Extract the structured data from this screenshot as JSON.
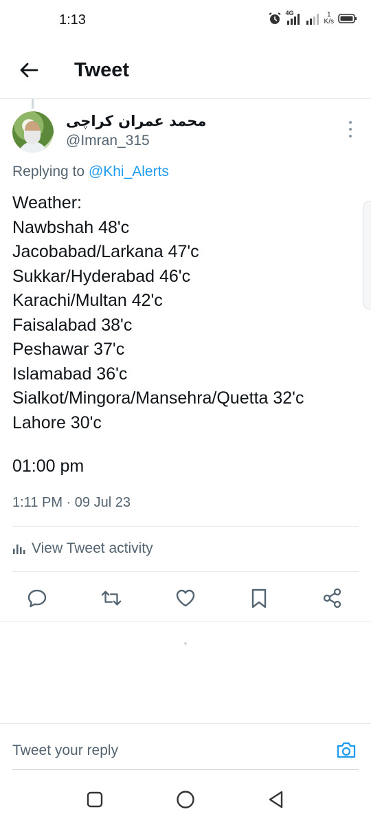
{
  "status_bar": {
    "time": "1:13",
    "network_type": "4G",
    "speed_value": "1",
    "speed_unit": "K/s",
    "icons": [
      "alarm-icon",
      "signal-icon",
      "signal-icon",
      "battery-icon"
    ]
  },
  "header": {
    "title": "Tweet",
    "back_icon": "arrow-left-icon"
  },
  "tweet": {
    "author_name": "محمد عمران کراچی",
    "author_handle": "@Imran_315",
    "replying_prefix": "Replying to",
    "replying_handle": "@Khi_Alerts",
    "lines": [
      "Weather:",
      "Nawbshah 48'c",
      "Jacobabad/Larkana 47'c",
      "Sukkar/Hyderabad 46'c",
      "Karachi/Multan 42'c",
      "Faisalabad 38'c",
      "Peshawar 37'c",
      "Islamabad 36'c",
      "Sialkot/Mingora/Mansehra/Quetta 32'c",
      "Lahore 30'c"
    ],
    "time_line": "01:00 pm",
    "timestamp": "1:11 PM · 09 Jul 23",
    "activity_label": "View Tweet activity"
  },
  "actions": [
    "reply-icon",
    "retweet-icon",
    "like-icon",
    "bookmark-icon",
    "share-icon"
  ],
  "reply_box": {
    "placeholder": "Tweet your reply"
  },
  "colors": {
    "accent": "#1d9bf0",
    "text": "#0f1419",
    "secondary": "#536471"
  }
}
